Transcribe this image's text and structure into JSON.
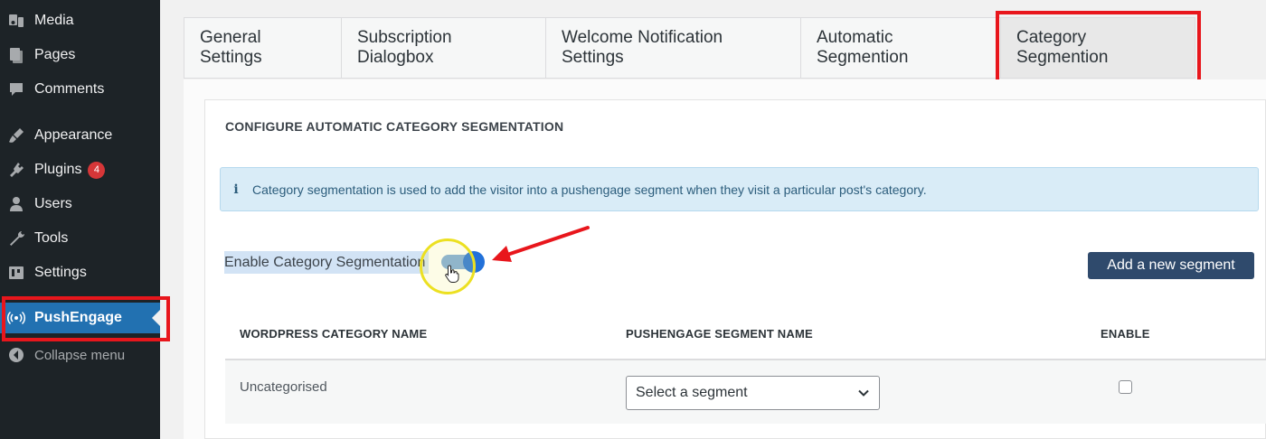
{
  "sidebar": {
    "items": [
      {
        "label": "Media",
        "icon": "media-icon"
      },
      {
        "label": "Pages",
        "icon": "pages-icon"
      },
      {
        "label": "Comments",
        "icon": "comments-icon"
      },
      {
        "label": "Appearance",
        "icon": "appearance-icon"
      },
      {
        "label": "Plugins",
        "icon": "plugins-icon",
        "badge": "4"
      },
      {
        "label": "Users",
        "icon": "users-icon"
      },
      {
        "label": "Tools",
        "icon": "tools-icon"
      },
      {
        "label": "Settings",
        "icon": "settings-icon"
      },
      {
        "label": "PushEngage",
        "icon": "broadcast-icon",
        "active": true
      }
    ],
    "collapse_label": "Collapse menu"
  },
  "tabs": [
    {
      "label": "General Settings"
    },
    {
      "label": "Subscription Dialogbox"
    },
    {
      "label": "Welcome Notification Settings"
    },
    {
      "label": "Automatic Segmention"
    },
    {
      "label": "Category Segmention",
      "active": true
    }
  ],
  "main": {
    "section_title": "CONFIGURE AUTOMATIC CATEGORY SEGMENTATION",
    "info_text": "Category segmentation is used to add the visitor into a pushengage segment when they visit a particular post's category.",
    "toggle_label": "Enable Category Segmentation",
    "toggle_on": true,
    "add_button": "Add a new segment",
    "table": {
      "headers": [
        "WORDPRESS CATEGORY NAME",
        "PUSHENGAGE SEGMENT NAME",
        "ENABLE"
      ],
      "rows": [
        {
          "category": "Uncategorised",
          "segment_placeholder": "Select a segment",
          "enabled": false
        }
      ]
    }
  },
  "colors": {
    "sidebar_bg": "#1d2327",
    "active_menu": "#2271b1",
    "highlight_red": "#e8161c",
    "button_bg": "#2f4a6c",
    "info_bg": "#d9ecf7"
  }
}
